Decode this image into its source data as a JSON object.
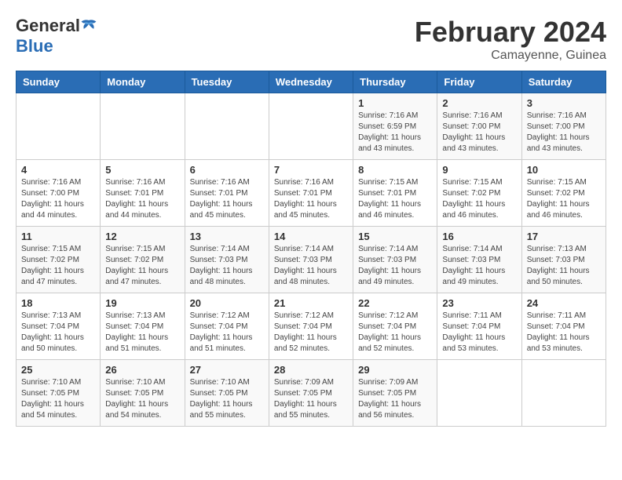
{
  "header": {
    "logo_general": "General",
    "logo_blue": "Blue",
    "month_year": "February 2024",
    "location": "Camayenne, Guinea"
  },
  "calendar": {
    "days_of_week": [
      "Sunday",
      "Monday",
      "Tuesday",
      "Wednesday",
      "Thursday",
      "Friday",
      "Saturday"
    ],
    "weeks": [
      [
        {
          "day": "",
          "info": ""
        },
        {
          "day": "",
          "info": ""
        },
        {
          "day": "",
          "info": ""
        },
        {
          "day": "",
          "info": ""
        },
        {
          "day": "1",
          "info": "Sunrise: 7:16 AM\nSunset: 6:59 PM\nDaylight: 11 hours\nand 43 minutes."
        },
        {
          "day": "2",
          "info": "Sunrise: 7:16 AM\nSunset: 7:00 PM\nDaylight: 11 hours\nand 43 minutes."
        },
        {
          "day": "3",
          "info": "Sunrise: 7:16 AM\nSunset: 7:00 PM\nDaylight: 11 hours\nand 43 minutes."
        }
      ],
      [
        {
          "day": "4",
          "info": "Sunrise: 7:16 AM\nSunset: 7:00 PM\nDaylight: 11 hours\nand 44 minutes."
        },
        {
          "day": "5",
          "info": "Sunrise: 7:16 AM\nSunset: 7:01 PM\nDaylight: 11 hours\nand 44 minutes."
        },
        {
          "day": "6",
          "info": "Sunrise: 7:16 AM\nSunset: 7:01 PM\nDaylight: 11 hours\nand 45 minutes."
        },
        {
          "day": "7",
          "info": "Sunrise: 7:16 AM\nSunset: 7:01 PM\nDaylight: 11 hours\nand 45 minutes."
        },
        {
          "day": "8",
          "info": "Sunrise: 7:15 AM\nSunset: 7:01 PM\nDaylight: 11 hours\nand 46 minutes."
        },
        {
          "day": "9",
          "info": "Sunrise: 7:15 AM\nSunset: 7:02 PM\nDaylight: 11 hours\nand 46 minutes."
        },
        {
          "day": "10",
          "info": "Sunrise: 7:15 AM\nSunset: 7:02 PM\nDaylight: 11 hours\nand 46 minutes."
        }
      ],
      [
        {
          "day": "11",
          "info": "Sunrise: 7:15 AM\nSunset: 7:02 PM\nDaylight: 11 hours\nand 47 minutes."
        },
        {
          "day": "12",
          "info": "Sunrise: 7:15 AM\nSunset: 7:02 PM\nDaylight: 11 hours\nand 47 minutes."
        },
        {
          "day": "13",
          "info": "Sunrise: 7:14 AM\nSunset: 7:03 PM\nDaylight: 11 hours\nand 48 minutes."
        },
        {
          "day": "14",
          "info": "Sunrise: 7:14 AM\nSunset: 7:03 PM\nDaylight: 11 hours\nand 48 minutes."
        },
        {
          "day": "15",
          "info": "Sunrise: 7:14 AM\nSunset: 7:03 PM\nDaylight: 11 hours\nand 49 minutes."
        },
        {
          "day": "16",
          "info": "Sunrise: 7:14 AM\nSunset: 7:03 PM\nDaylight: 11 hours\nand 49 minutes."
        },
        {
          "day": "17",
          "info": "Sunrise: 7:13 AM\nSunset: 7:03 PM\nDaylight: 11 hours\nand 50 minutes."
        }
      ],
      [
        {
          "day": "18",
          "info": "Sunrise: 7:13 AM\nSunset: 7:04 PM\nDaylight: 11 hours\nand 50 minutes."
        },
        {
          "day": "19",
          "info": "Sunrise: 7:13 AM\nSunset: 7:04 PM\nDaylight: 11 hours\nand 51 minutes."
        },
        {
          "day": "20",
          "info": "Sunrise: 7:12 AM\nSunset: 7:04 PM\nDaylight: 11 hours\nand 51 minutes."
        },
        {
          "day": "21",
          "info": "Sunrise: 7:12 AM\nSunset: 7:04 PM\nDaylight: 11 hours\nand 52 minutes."
        },
        {
          "day": "22",
          "info": "Sunrise: 7:12 AM\nSunset: 7:04 PM\nDaylight: 11 hours\nand 52 minutes."
        },
        {
          "day": "23",
          "info": "Sunrise: 7:11 AM\nSunset: 7:04 PM\nDaylight: 11 hours\nand 53 minutes."
        },
        {
          "day": "24",
          "info": "Sunrise: 7:11 AM\nSunset: 7:04 PM\nDaylight: 11 hours\nand 53 minutes."
        }
      ],
      [
        {
          "day": "25",
          "info": "Sunrise: 7:10 AM\nSunset: 7:05 PM\nDaylight: 11 hours\nand 54 minutes."
        },
        {
          "day": "26",
          "info": "Sunrise: 7:10 AM\nSunset: 7:05 PM\nDaylight: 11 hours\nand 54 minutes."
        },
        {
          "day": "27",
          "info": "Sunrise: 7:10 AM\nSunset: 7:05 PM\nDaylight: 11 hours\nand 55 minutes."
        },
        {
          "day": "28",
          "info": "Sunrise: 7:09 AM\nSunset: 7:05 PM\nDaylight: 11 hours\nand 55 minutes."
        },
        {
          "day": "29",
          "info": "Sunrise: 7:09 AM\nSunset: 7:05 PM\nDaylight: 11 hours\nand 56 minutes."
        },
        {
          "day": "",
          "info": ""
        },
        {
          "day": "",
          "info": ""
        }
      ]
    ]
  }
}
